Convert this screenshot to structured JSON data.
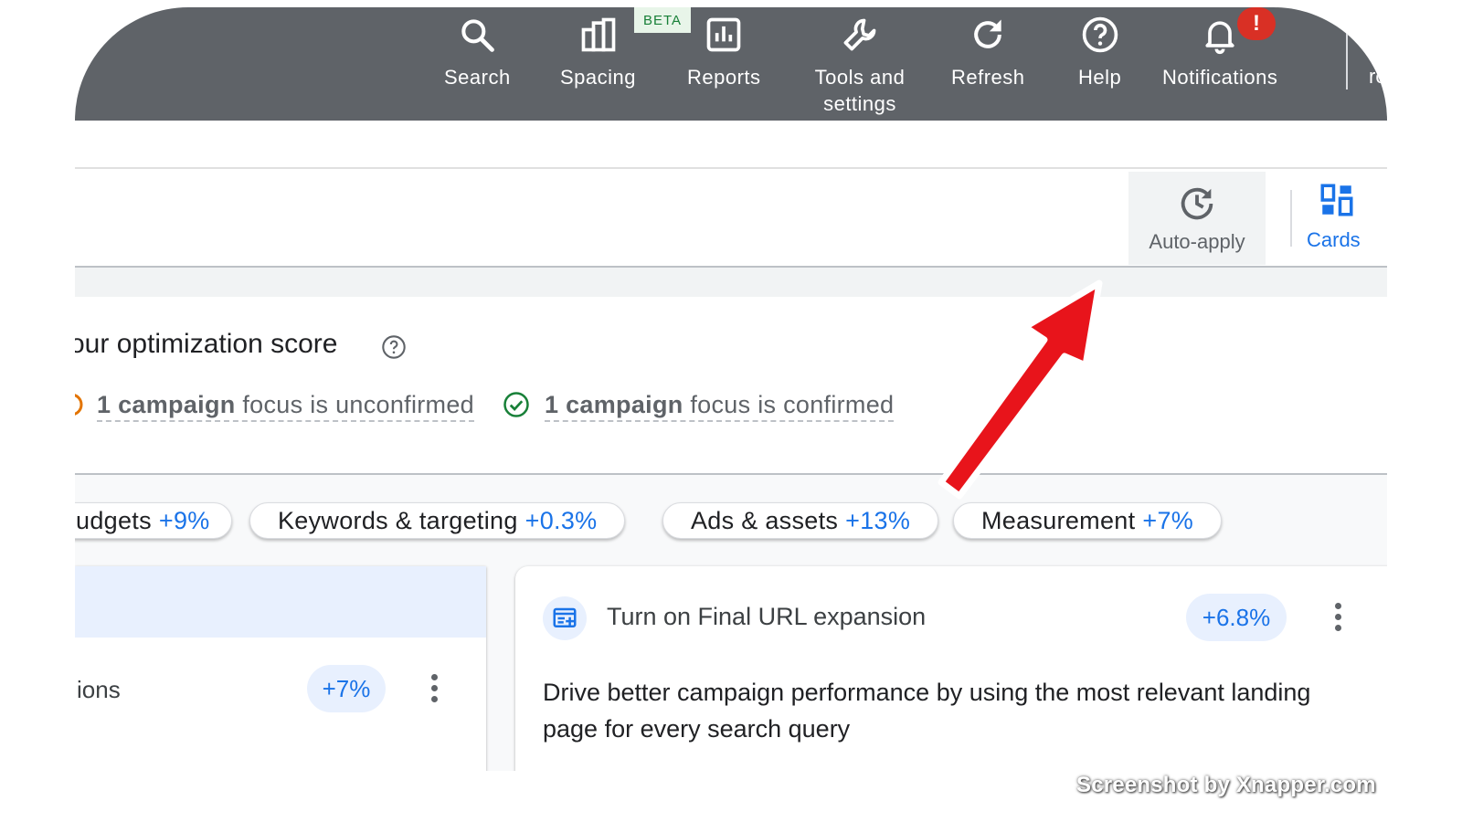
{
  "topbar": {
    "items": [
      {
        "label": "Search",
        "icon": "search-icon"
      },
      {
        "label": "Spacing",
        "icon": "spacing-icon"
      },
      {
        "label": "Reports",
        "icon": "reports-icon"
      },
      {
        "label": "Tools and settings",
        "icon": "wrench-icon"
      },
      {
        "label": "Refresh",
        "icon": "refresh-icon"
      },
      {
        "label": "Help",
        "icon": "help-icon"
      },
      {
        "label": "Notifications",
        "icon": "bell-icon"
      }
    ],
    "beta_badge": "BETA",
    "notification_badge": "!",
    "cut_text": "ro"
  },
  "toolbar": {
    "auto_apply": "Auto-apply",
    "cards": "Cards"
  },
  "score": {
    "title": "our optimization score",
    "unconfirmed": {
      "bold": "1 campaign",
      "text": " focus is unconfirmed"
    },
    "confirmed": {
      "bold": "1 campaign",
      "text": " focus is confirmed"
    }
  },
  "chips": [
    {
      "label": "udgets",
      "pct": "+9%"
    },
    {
      "label": "Keywords & targeting",
      "pct": "+0.3%"
    },
    {
      "label": "Ads & assets",
      "pct": "+13%"
    },
    {
      "label": "Measurement",
      "pct": "+7%"
    }
  ],
  "card_left": {
    "label": "ions",
    "pct": "+7%"
  },
  "card_right": {
    "title": "Turn on Final URL expansion",
    "pct": "+6.8%",
    "description": "Drive better campaign performance by using the most relevant landing page for every search query"
  },
  "watermark": "Screenshot by Xnapper.com",
  "colors": {
    "topbar": "#5f6368",
    "accent": "#1a73e8",
    "alert": "#d93025",
    "arrow": "#e8141b"
  }
}
